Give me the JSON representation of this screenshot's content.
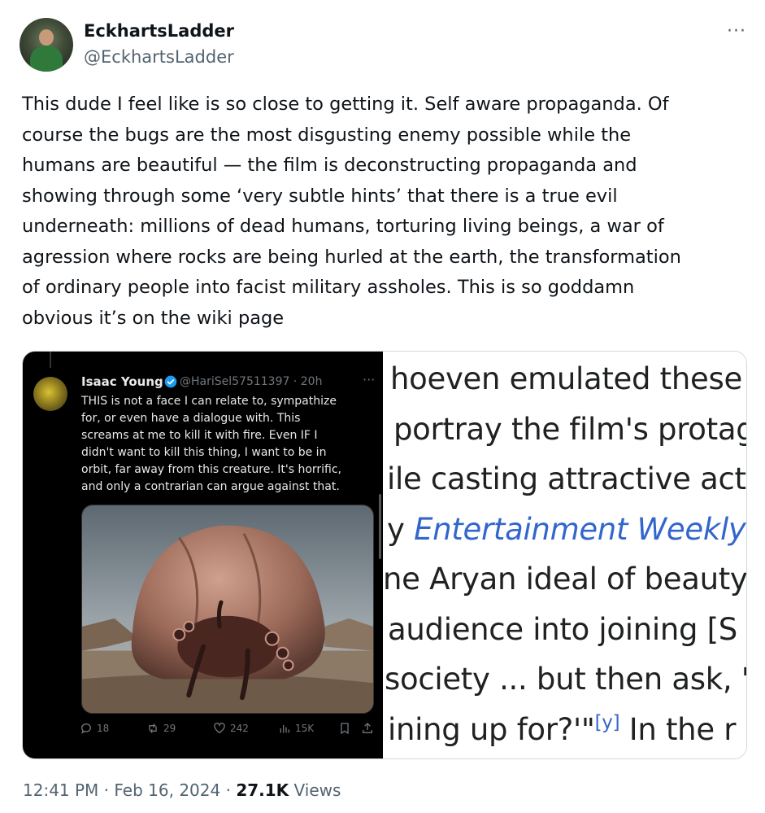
{
  "author": {
    "display_name": "EckhartsLadder",
    "handle": "@EckhartsLadder"
  },
  "more_label": "···",
  "tweet_text": "This dude I feel like is so close to getting it. Self aware propaganda. Of\ncourse the bugs are the most disgusting enemy possible while the\nhumans are beautiful — the film is deconstructing propaganda and\nshowing through some ‘very subtle hints’ that there is a true evil\nunderneath: millions of dead humans, torturing living beings, a war of\nagression where rocks are being hurled at the earth, the transformation\nof ordinary people into facist military assholes. This is so goddamn\nobvious it’s on the wiki page",
  "embedded_tweet": {
    "display_name": "Isaac Young",
    "handle_time": "@HariSel57511397 · 20h",
    "more_label": "···",
    "text": "THIS is not a face I can relate to, sympathize\nfor, or even have a dialogue with. This\nscreams at me to kill it with fire. Even IF I\ndidn't want to kill this thing, I want to be in\norbit, far away from this creature. It's horrific,\nand only a contrarian can argue against that.",
    "actions": {
      "replies": "18",
      "retweets": "29",
      "likes": "242",
      "views": "15K"
    }
  },
  "wiki_excerpt": {
    "line1": "hoeven emulated these",
    "line2": "portray the film's protag",
    "line3": "ile casting attractive act",
    "line4_prefix": "y ",
    "line4_link": "Entertainment Weekly",
    "line5": "ne Aryan ideal of beauty",
    "line6": "audience into joining [S",
    "line7": "society ... but then ask, '",
    "line8_text": "ining up for?'\"",
    "line8_sup": "[y]",
    "line8_suffix": " In the r"
  },
  "meta": {
    "time": "12:41 PM",
    "separator1": " · ",
    "date": "Feb 16, 2024",
    "separator2": " · ",
    "views_count": "27.1K",
    "views_label": " Views"
  },
  "colors": {
    "text_primary": "#0f1419",
    "text_secondary": "#536471",
    "link_blue": "#3366cc",
    "verified_blue": "#1d9bf0"
  }
}
